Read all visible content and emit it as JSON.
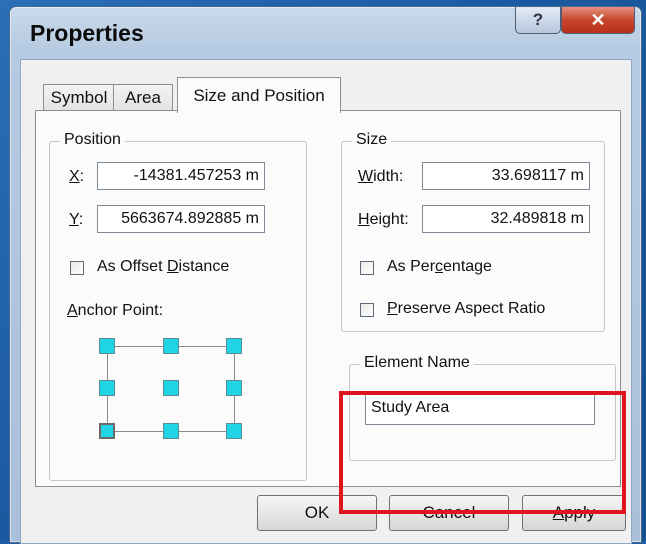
{
  "window": {
    "title": "Properties",
    "help_glyph": "?",
    "close_glyph": "✕"
  },
  "tabs": [
    {
      "label": "Symbol",
      "active": false
    },
    {
      "label": "Area",
      "active": false
    },
    {
      "label": "Size and Position",
      "active": true
    }
  ],
  "position": {
    "group_label": "Position",
    "x": {
      "accel": "X",
      "rest": ":",
      "value": "-14381.457253 m"
    },
    "y": {
      "accel": "Y",
      "rest": ":",
      "value": "5663674.892885 m"
    },
    "offset_checkbox": {
      "pre": "As Offset ",
      "accel": "D",
      "post": "istance",
      "checked": false
    },
    "anchor_label": {
      "accel": "A",
      "rest": "nchor Point:"
    },
    "anchor_selected": "bottom-left"
  },
  "size": {
    "group_label": "Size",
    "width": {
      "accel": "W",
      "rest": "idth:",
      "value": "33.698117 m"
    },
    "height": {
      "accel": "H",
      "rest": "eight:",
      "value": "32.489818 m"
    },
    "percentage_checkbox": {
      "pre": "As Per",
      "accel": "c",
      "post": "entage",
      "checked": false
    },
    "aspect_checkbox": {
      "pre": "",
      "accel": "P",
      "post": "reserve Aspect Ratio",
      "checked": false
    }
  },
  "element_name": {
    "group_label": "Element Name",
    "value": "Study Area"
  },
  "buttons": {
    "ok": "OK",
    "cancel": "Cancel",
    "apply_accel": "A",
    "apply_rest": "pply"
  },
  "colors": {
    "highlight": "#e0141f",
    "anchor_fill": "#20d4e6",
    "close_button": "#c7452d"
  }
}
